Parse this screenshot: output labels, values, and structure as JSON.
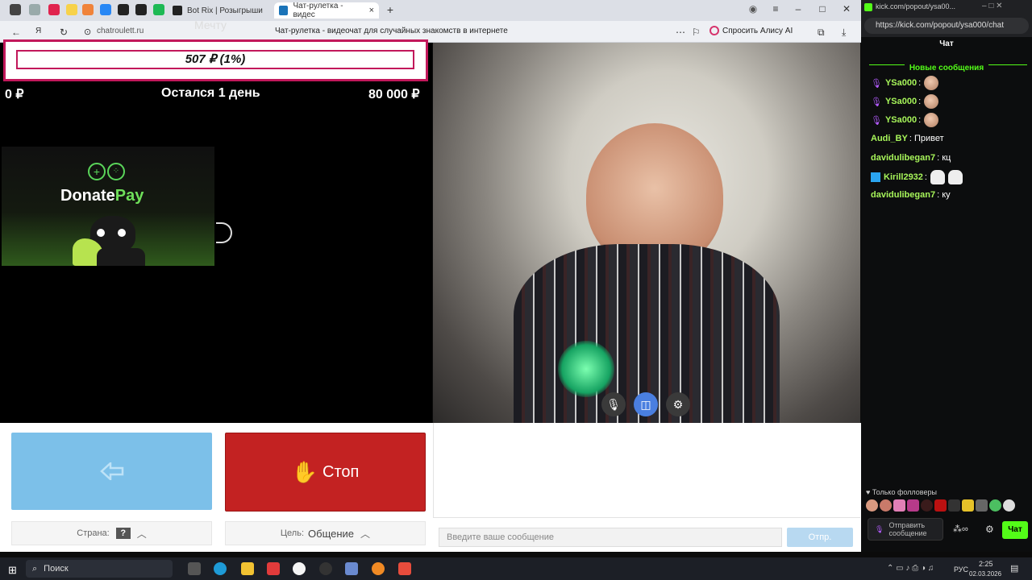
{
  "browser": {
    "tabs": [
      {
        "label": "Bot Rix | Розыгрыши"
      },
      {
        "label": "Чат-рулетка - видес"
      }
    ],
    "url": "chatroulett.ru",
    "page_title": "Чат-рулетка - видеочат для случайных знакомств в интернете",
    "alice_label": "Спросить Алису AI",
    "overlay_text": "Мечту"
  },
  "goal": {
    "amount_text": "507 ₽ (1%)",
    "min": "0 ₽",
    "remaining": "Остался 1 день",
    "max": "80 000 ₽"
  },
  "donate": {
    "brand_a": "Donate",
    "brand_b": "Pay"
  },
  "controls": {
    "stop_label": "Стоп",
    "country_label": "Страна:",
    "country_value": "?",
    "goal_label": "Цель:",
    "goal_value": "Общение",
    "message_placeholder": "Введите ваше сообщение",
    "send_label": "Отпр."
  },
  "chat": {
    "url": "https://kick.com/popout/ysa000/chat",
    "tab_url": "kick.com/popout/ysa00...",
    "title": "Чат",
    "new_messages": "Новые сообщения",
    "messages": [
      {
        "user": "YSa000",
        "text": "",
        "color": "#a7f55a"
      },
      {
        "user": "YSa000",
        "text": "",
        "color": "#a7f55a"
      },
      {
        "user": "YSa000",
        "text": "",
        "color": "#a7f55a"
      },
      {
        "user": "Audi_BY",
        "text": "Привет",
        "color": "#a7f55a"
      },
      {
        "user": "davidulibegan7",
        "text": "кц",
        "color": "#a7f55a"
      },
      {
        "user": "Kirill2932",
        "text": "",
        "color": "#a7f55a"
      },
      {
        "user": "davidulibegan7",
        "text": "ку",
        "color": "#a7f55a"
      }
    ],
    "followers_only": "Только фолловеры",
    "send_placeholder": "Отправить сообщение",
    "chat_button": "Чат"
  },
  "taskbar": {
    "search": "Поиск",
    "lang": "РУС",
    "time": "2:25",
    "date": "02.03.2026"
  },
  "colors": {
    "accent_pink": "#c2185b",
    "stop_red": "#c32222",
    "next_blue": "#7cc0e9",
    "kick_green": "#53fc18"
  }
}
